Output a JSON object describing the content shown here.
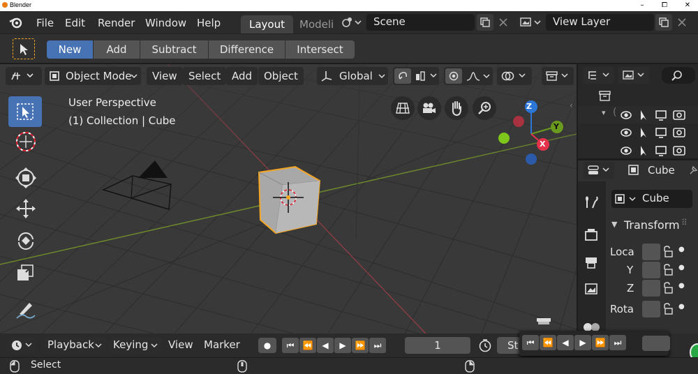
{
  "window": {
    "title": "Blender",
    "controls": [
      "–",
      "⧠",
      "✕"
    ]
  },
  "menu": {
    "items": [
      "File",
      "Edit",
      "Render",
      "Window",
      "Help"
    ],
    "tabs": [
      "Layout",
      "Modeli"
    ],
    "scene": "Scene",
    "view_layer": "View Layer"
  },
  "tool_header": {
    "ops": [
      "New",
      "Add",
      "Subtract",
      "Difference",
      "Intersect"
    ]
  },
  "viewport_header": {
    "mode": "Object Mode",
    "menus": [
      "View",
      "Select",
      "Add",
      "Object"
    ],
    "orientation": "Global"
  },
  "viewport": {
    "perspective": "User Perspective",
    "collection": "(1) Collection | Cube",
    "gizmo": {
      "z": "Z",
      "y": "Y",
      "x": "X"
    }
  },
  "properties": {
    "object_name": "Cube",
    "data_name": "Cube",
    "panel": "Transform",
    "rows": [
      "Loca",
      "Y",
      "Z",
      "Rota"
    ]
  },
  "timeline": {
    "menus": [
      "Playback",
      "Keying",
      "View",
      "Marker"
    ],
    "frame": "1",
    "start_label": "St"
  },
  "status": {
    "left": "Select"
  },
  "colors": {
    "accent": "#4772b3",
    "selection": "#f5a623",
    "axis_x": "#e5324b",
    "axis_y": "#6b9b1e",
    "axis_z": "#2c76d8"
  }
}
